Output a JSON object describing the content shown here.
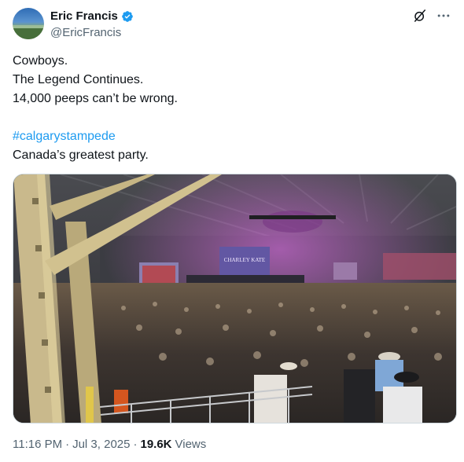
{
  "author": {
    "display_name": "Eric Francis",
    "handle": "@EricFrancis"
  },
  "post": {
    "lines": [
      "Cowboys.",
      "The Legend Continues.",
      "14,000 peeps can’t be wrong."
    ],
    "hashtag": "#calgarystampede",
    "tagline": "Canada’s greatest party."
  },
  "media": {
    "screen_text": "CHARLEY KATE"
  },
  "footer": {
    "time": "11:16 PM",
    "separator": "·",
    "date": "Jul 3, 2025",
    "separator2": "·",
    "views": "19.6K",
    "views_label": "Views"
  },
  "icons": {
    "verified": "verified-badge-icon",
    "grok": "grok-icon",
    "more": "more-icon"
  },
  "colors": {
    "accent": "#1d9bf0",
    "text": "#0f1419",
    "secondary": "#536471"
  }
}
